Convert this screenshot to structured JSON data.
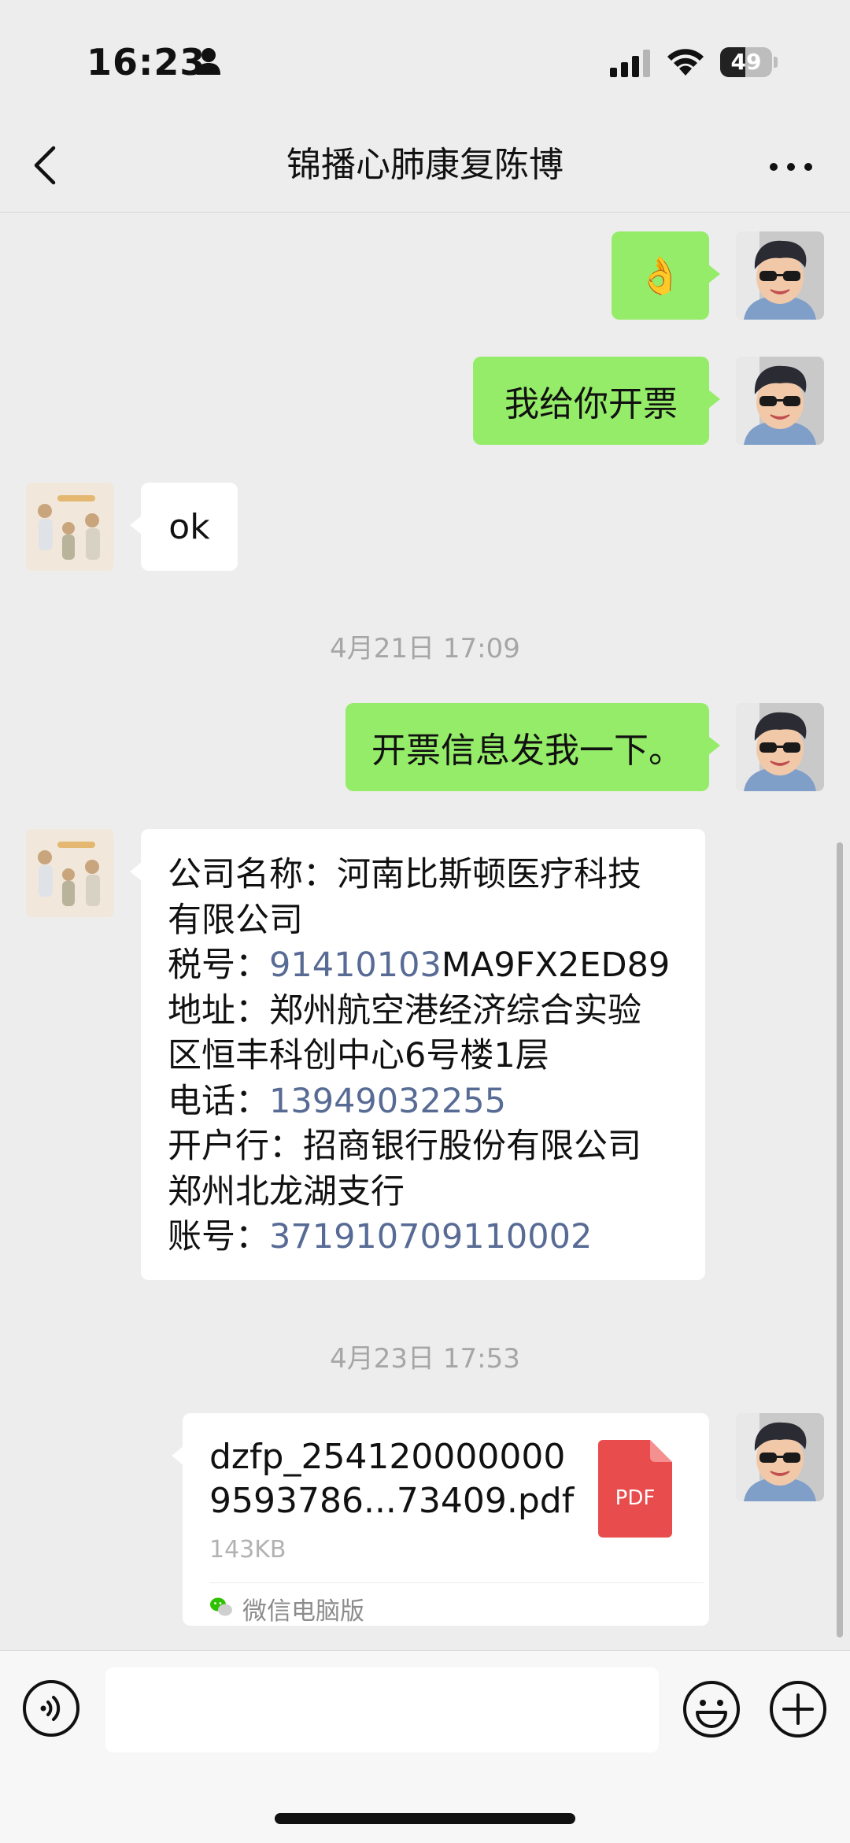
{
  "status_bar": {
    "time": "16:23",
    "battery": "49",
    "battery_level_percent": 49,
    "icons": [
      "person-icon",
      "signal-icon",
      "wifi-icon",
      "battery-icon"
    ]
  },
  "nav": {
    "title": "锦播心肺康复陈博",
    "back_icon": "chevron-left-icon",
    "more_icon": "more-dots-icon"
  },
  "messages": {
    "m1_emoji": "👌",
    "m2_text": "我给你开票",
    "m3_text": "ok",
    "timestamp_1": "4月21日 17:09",
    "m4_text": "开票信息发我一下。",
    "invoice": {
      "company_label": "公司名称：",
      "company_part1": "河南比斯顿医疗科技",
      "company_part2": "有限公司",
      "tax_label": "税号：",
      "tax_link": "91410103",
      "tax_rest": "MA9FX2ED89",
      "address_label": "地址：",
      "address_part1": "郑州航空港经济综合实验",
      "address_part2": "区恒丰科创中心6号楼1层",
      "phone_label": "电话：",
      "phone_value": "13949032255",
      "bank_label": "开户行：",
      "bank_part1": "招商银行股份有限公司",
      "bank_part2": "郑州北龙湖支行",
      "account_label": "账号：",
      "account_value": "371910709110002"
    },
    "timestamp_2": "4月23日 17:53",
    "file": {
      "name_line1": "dzfp_254120000000",
      "name_line2": "9593786...73409.pdf",
      "size": "143KB",
      "pdf_label": "PDF",
      "source": "微信电脑版"
    }
  },
  "input_bar": {
    "placeholder": "",
    "icons": [
      "voice-icon",
      "emoji-icon",
      "plus-icon"
    ]
  },
  "colors": {
    "background": "#ededed",
    "my_bubble": "#95ec69",
    "their_bubble": "#ffffff",
    "link": "#576b95",
    "pdf_red": "#e84c4c"
  }
}
